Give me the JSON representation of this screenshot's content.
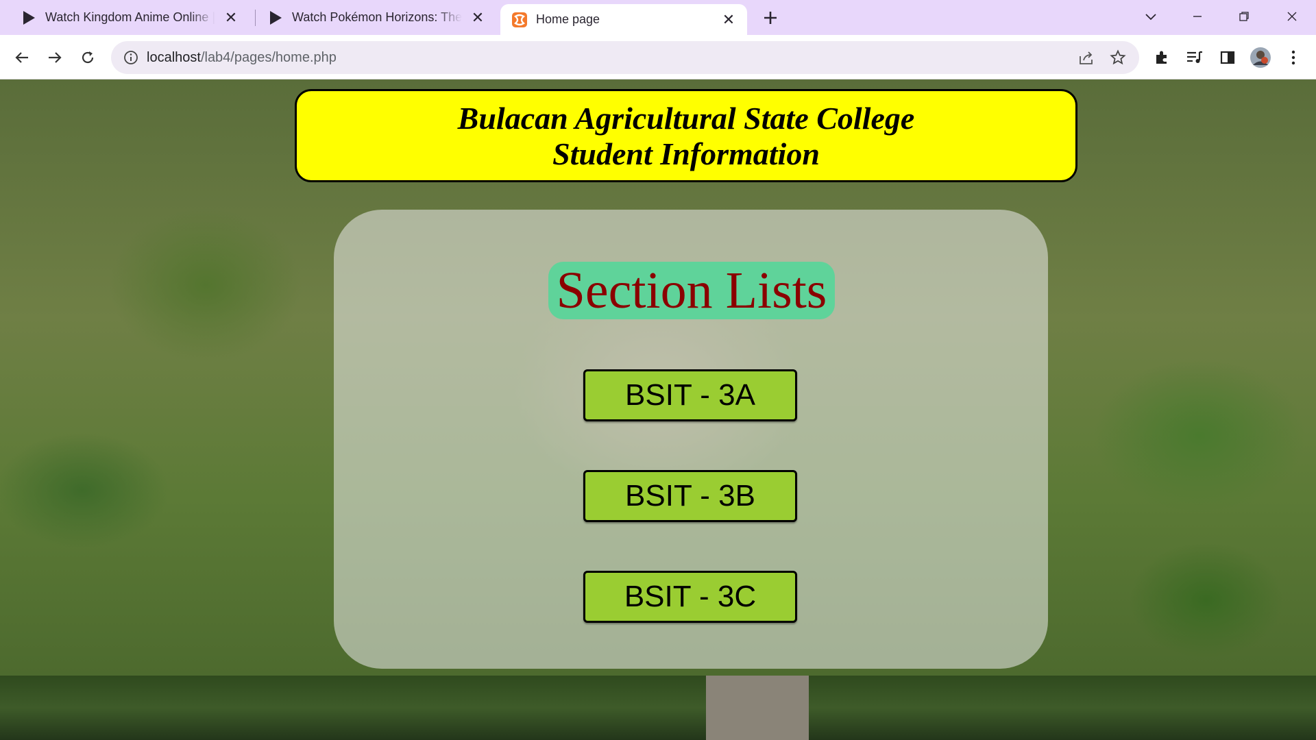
{
  "browser": {
    "tabs": [
      {
        "title": "Watch Kingdom Anime Online |",
        "icon": "play-icon",
        "active": false
      },
      {
        "title": "Watch Pokémon Horizons: The S",
        "icon": "play-icon",
        "active": false
      },
      {
        "title": "Home page",
        "icon": "xampp-icon",
        "active": true
      }
    ],
    "url_host": "localhost",
    "url_path": "/lab4/pages/home.php"
  },
  "page": {
    "header": {
      "line1": "Bulacan Agricultural State College",
      "line2": "Student Information"
    },
    "section_title": "Section Lists",
    "sections": [
      {
        "label": "BSIT - 3A"
      },
      {
        "label": "BSIT - 3B"
      },
      {
        "label": "BSIT - 3C"
      }
    ]
  },
  "colors": {
    "header_bg": "#ffff00",
    "section_title_bg": "#5fd39a",
    "section_title_text": "#8b0000",
    "button_bg": "#9acd32",
    "tabstrip_bg": "#e8d7fb"
  }
}
